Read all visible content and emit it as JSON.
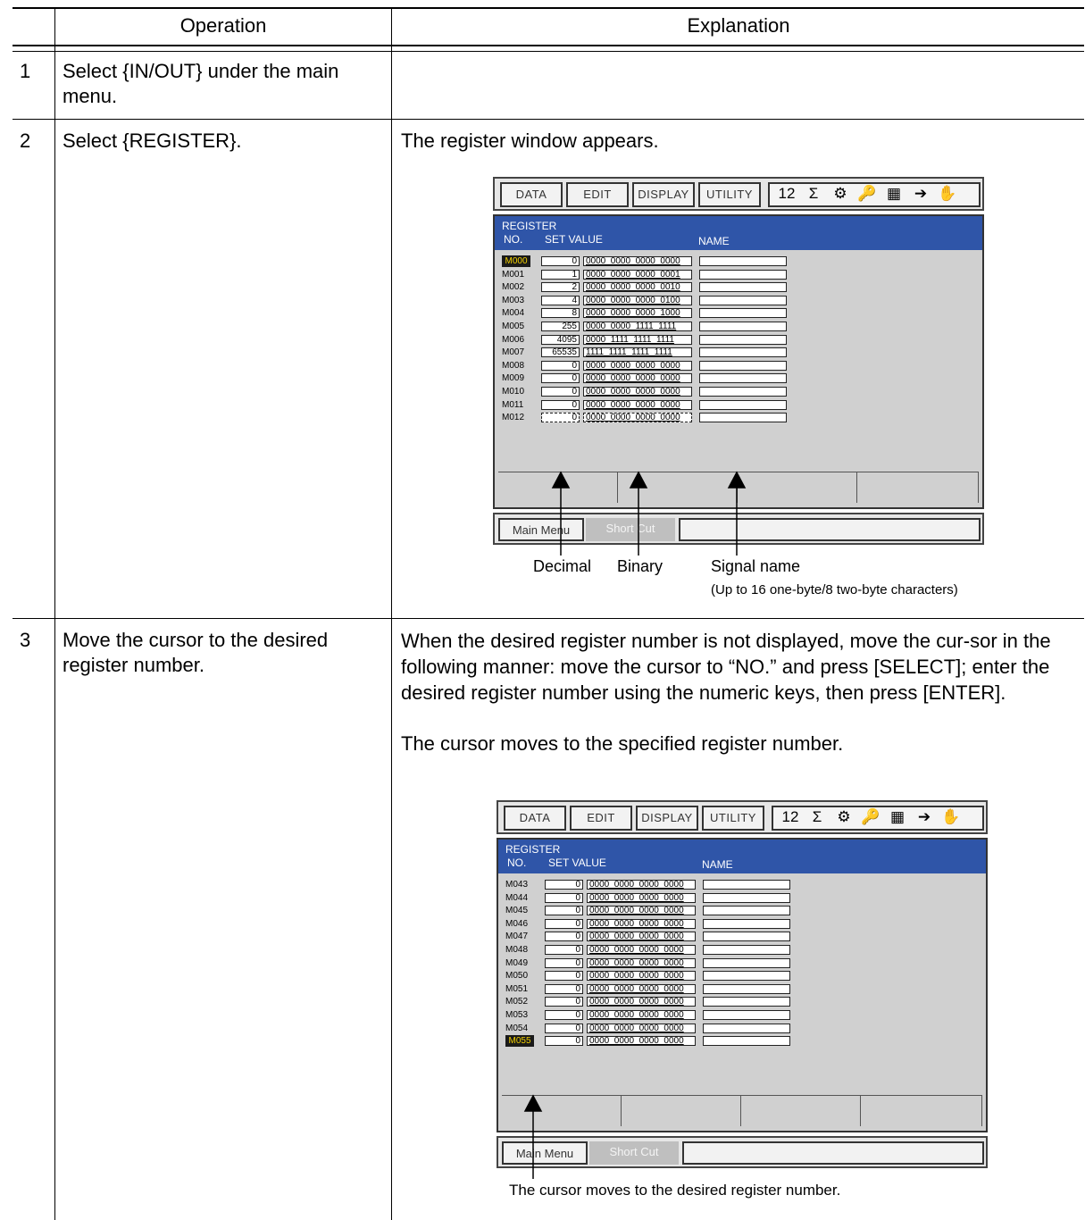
{
  "table": {
    "header_operation": "Operation",
    "header_explanation": "Explanation",
    "rows": [
      {
        "num": "1",
        "operation": "Select {IN/OUT} under the main menu.",
        "explanation": ""
      },
      {
        "num": "2",
        "operation": "Select {REGISTER}.",
        "explanation": "The register window appears."
      },
      {
        "num": "3",
        "operation": "Move the cursor to the desired register number.",
        "explanation": "When the desired register number is not displayed, move the cur-sor in the following manner: move the cursor to “NO.” and press [SELECT]; enter the desired register number using the numeric keys, then press [ENTER].",
        "explanation2": "The cursor moves to the specified register number."
      }
    ]
  },
  "screen": {
    "menu": [
      "DATA",
      "EDIT",
      "DISPLAY",
      "UTILITY"
    ],
    "icons": [
      "12",
      "Σ",
      "⚙",
      "🔑",
      "▦",
      "➔",
      "✋"
    ],
    "title": "REGISTER",
    "col_no": "NO.",
    "col_set": "SET VALUE",
    "col_name": "NAME",
    "main_menu": "Main Menu",
    "short_cut": "Short Cut"
  },
  "screen1": {
    "rows": [
      {
        "no": "M000",
        "dec": "0",
        "bin": "0000_0000_0000_0000"
      },
      {
        "no": "M001",
        "dec": "1",
        "bin": "0000_0000_0000_0001"
      },
      {
        "no": "M002",
        "dec": "2",
        "bin": "0000_0000_0000_0010"
      },
      {
        "no": "M003",
        "dec": "4",
        "bin": "0000_0000_0000_0100"
      },
      {
        "no": "M004",
        "dec": "8",
        "bin": "0000_0000_0000_1000"
      },
      {
        "no": "M005",
        "dec": "255",
        "bin": "0000_0000_1111_1111"
      },
      {
        "no": "M006",
        "dec": "4095",
        "bin": "0000_1111_1111_1111"
      },
      {
        "no": "M007",
        "dec": "65535",
        "bin": "1111_1111_1111_1111"
      },
      {
        "no": "M008",
        "dec": "0",
        "bin": "0000_0000_0000_0000"
      },
      {
        "no": "M009",
        "dec": "0",
        "bin": "0000_0000_0000_0000"
      },
      {
        "no": "M010",
        "dec": "0",
        "bin": "0000_0000_0000_0000"
      },
      {
        "no": "M011",
        "dec": "0",
        "bin": "0000_0000_0000_0000"
      },
      {
        "no": "M012",
        "dec": "0",
        "bin": "0000_0000_0000_0000"
      }
    ],
    "callout_decimal": "Decimal",
    "callout_binary": "Binary",
    "callout_signal": "Signal name",
    "callout_signal_note": "(Up to 16 one-byte/8 two-byte characters)"
  },
  "screen2": {
    "rows": [
      {
        "no": "M043",
        "dec": "0",
        "bin": "0000_0000_0000_0000"
      },
      {
        "no": "M044",
        "dec": "0",
        "bin": "0000_0000_0000_0000"
      },
      {
        "no": "M045",
        "dec": "0",
        "bin": "0000_0000_0000_0000"
      },
      {
        "no": "M046",
        "dec": "0",
        "bin": "0000_0000_0000_0000"
      },
      {
        "no": "M047",
        "dec": "0",
        "bin": "0000_0000_0000_0000"
      },
      {
        "no": "M048",
        "dec": "0",
        "bin": "0000_0000_0000_0000"
      },
      {
        "no": "M049",
        "dec": "0",
        "bin": "0000_0000_0000_0000"
      },
      {
        "no": "M050",
        "dec": "0",
        "bin": "0000_0000_0000_0000"
      },
      {
        "no": "M051",
        "dec": "0",
        "bin": "0000_0000_0000_0000"
      },
      {
        "no": "M052",
        "dec": "0",
        "bin": "0000_0000_0000_0000"
      },
      {
        "no": "M053",
        "dec": "0",
        "bin": "0000_0000_0000_0000"
      },
      {
        "no": "M054",
        "dec": "0",
        "bin": "0000_0000_0000_0000"
      },
      {
        "no": "M055",
        "dec": "0",
        "bin": "0000_0000_0000_0000"
      }
    ],
    "callout_cursor": "The cursor moves to the desired register number."
  }
}
